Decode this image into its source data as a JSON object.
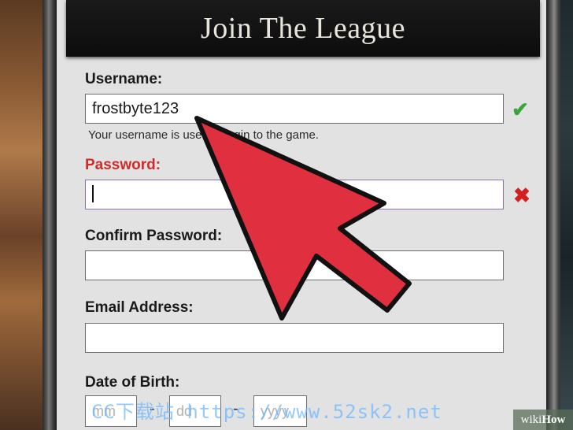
{
  "header": {
    "title": "Join The League"
  },
  "form": {
    "username": {
      "label": "Username:",
      "value": "frostbyte123",
      "hint": "Your username is used to login to the game.",
      "status": "check-icon"
    },
    "password": {
      "label": "Password:",
      "value": "",
      "status": "cross-icon"
    },
    "confirm_password": {
      "label": "Confirm Password:",
      "value": ""
    },
    "email": {
      "label": "Email Address:",
      "value": ""
    },
    "dob": {
      "label": "Date of Birth:",
      "month_placeholder": "mm",
      "day_placeholder": "dd",
      "year_placeholder": "yyyy",
      "separator": "-"
    }
  },
  "overlay": {
    "watermark": "CC下载站 https://www.52sk2.net",
    "brand_wiki": "wiki",
    "brand_how": "How"
  },
  "colors": {
    "error_label": "#d22a2a",
    "check": "#3aa53a",
    "cross": "#d21f1f",
    "arrow_fill": "#e03040"
  }
}
